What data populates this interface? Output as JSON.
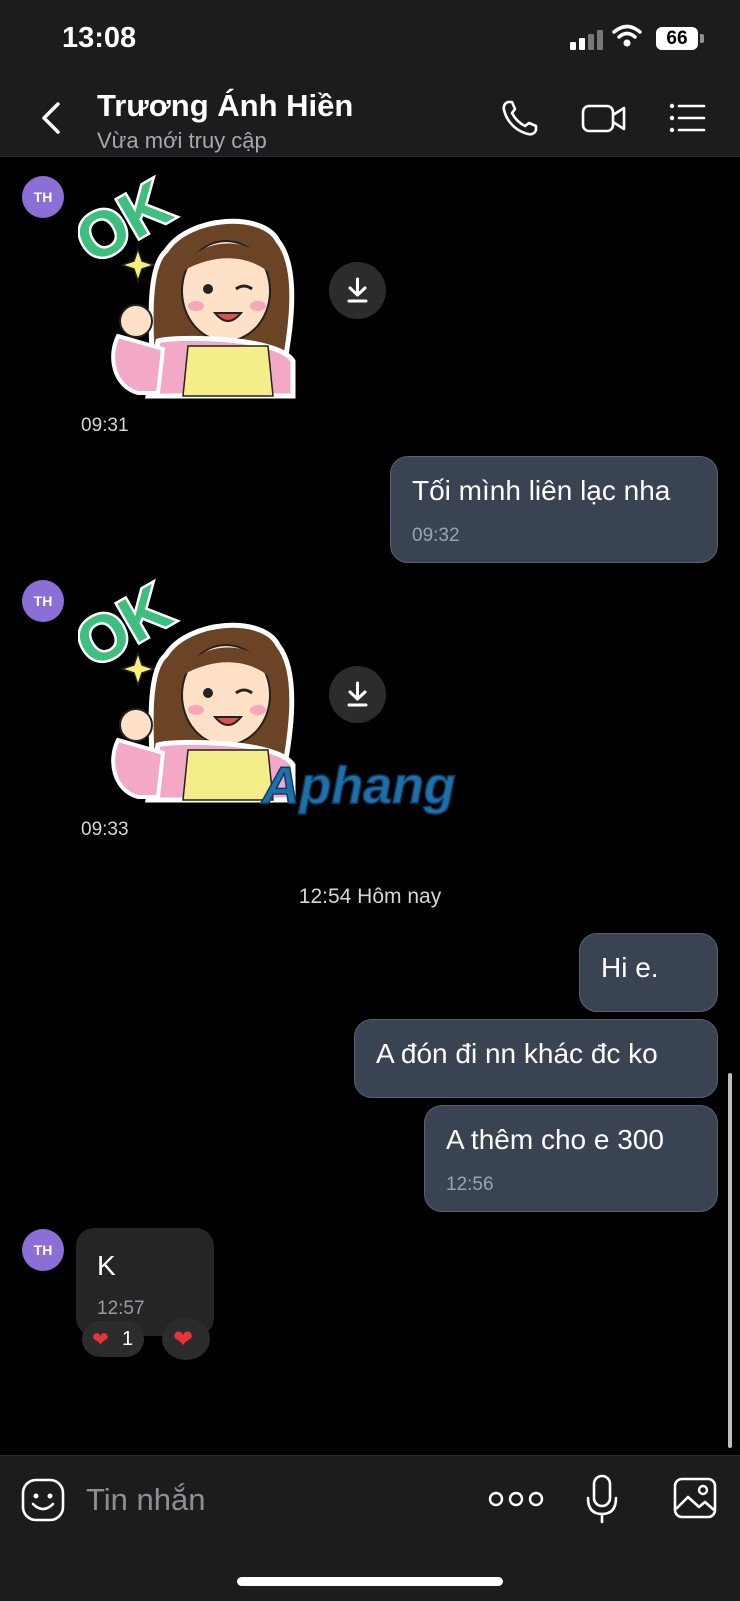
{
  "status": {
    "time": "13:08",
    "battery": "66"
  },
  "header": {
    "contact_name": "Trương Ánh Hiền",
    "presence": "Vừa mới truy cập"
  },
  "messages": {
    "sticker1": {
      "avatar": "TH",
      "time": "09:31"
    },
    "out1": {
      "text": "Tối mình liên lạc nha",
      "time": "09:32"
    },
    "sticker2": {
      "avatar": "TH",
      "time": "09:33",
      "ok_text": "OK"
    },
    "date_separator": "12:54 Hôm nay",
    "out2": {
      "text": "Hi e."
    },
    "out3": {
      "text": "A đón đi nn khác đc ko"
    },
    "out4": {
      "text": "A thêm cho e 300",
      "time": "12:56"
    },
    "in1": {
      "avatar": "TH",
      "text": "K",
      "time": "12:57",
      "reaction_count": "1"
    }
  },
  "watermark": {
    "text": "Aphang"
  },
  "input": {
    "placeholder": "Tin nhắn"
  },
  "colors": {
    "bubble_out": "#3a4352",
    "bubble_in": "#252527",
    "avatar": "#8b6fd6"
  }
}
